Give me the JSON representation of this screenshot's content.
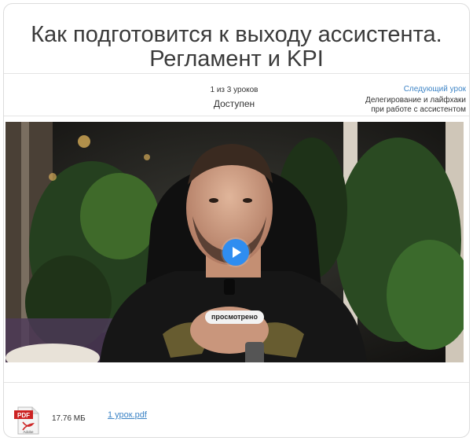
{
  "lesson": {
    "title_line1": "Как подготовится к выходу ассистента.",
    "title_line2": "Регламент и KPI"
  },
  "progress": {
    "count": "1 из 3 уроков",
    "status": "Доступен"
  },
  "next": {
    "label": "Следующий урок",
    "lesson_line1": "Делегирование и лайфхаки",
    "lesson_line2": "при работе с ассистентом"
  },
  "video": {
    "badge": "просмотрено",
    "play_icon": "play-icon"
  },
  "attachment": {
    "icon": "pdf-file-icon",
    "icon_label": "Adobe",
    "size": "17.76 МБ",
    "name": "1 урок.pdf"
  },
  "colors": {
    "accent": "#3d84c6",
    "play_button": "#2f8df0",
    "title_text": "#3a3a3a"
  }
}
